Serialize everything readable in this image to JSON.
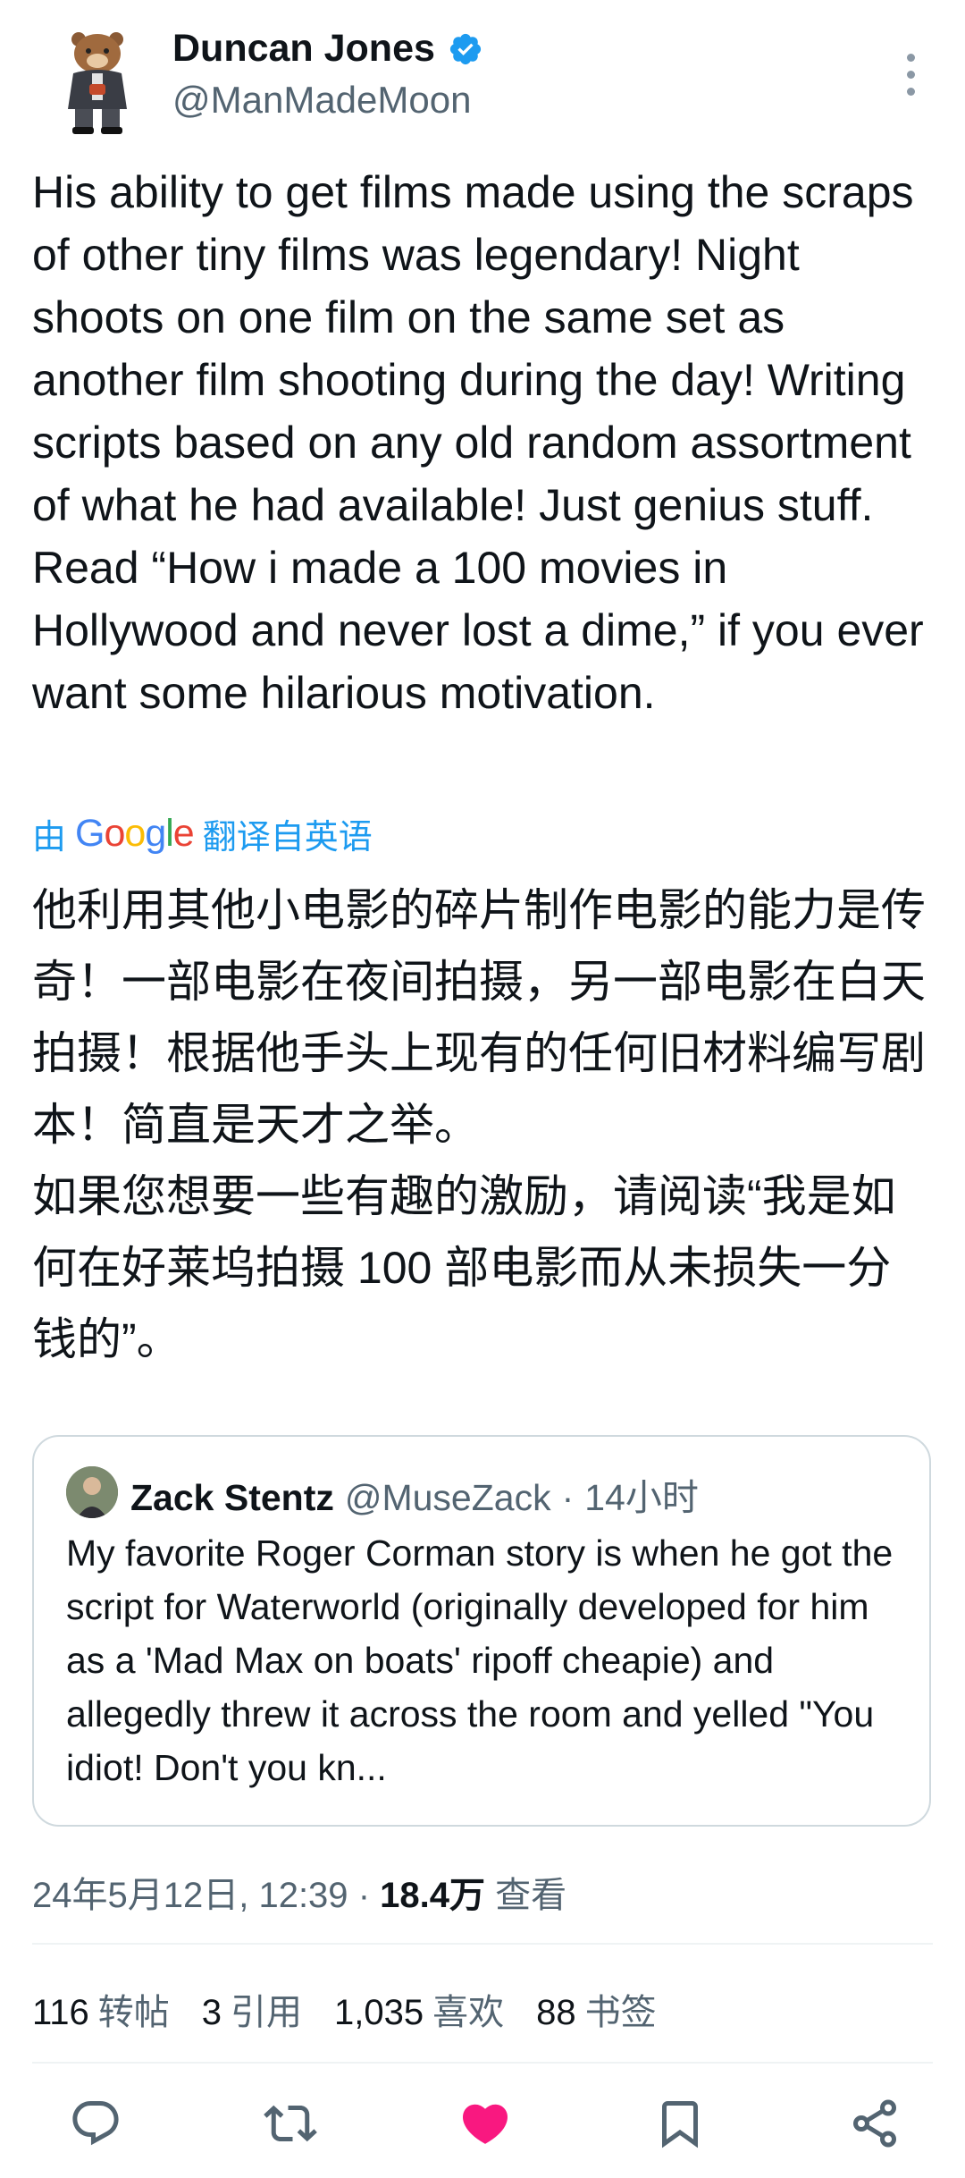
{
  "author": {
    "display_name": "Duncan Jones",
    "handle": "@ManMadeMoon",
    "verified_icon": "verified-badge-icon",
    "avatar_icon": "bear-avatar"
  },
  "tweet": {
    "text": "His ability to get films made using the scraps of other tiny films was legendary!  Night shoots on one film on the same set as another film shooting during the day!  Writing scripts based on any old random assortment of what he had available!  Just genius stuff.\nRead “How i made a 100 movies in Hollywood and never lost a dime,” if you ever want some hilarious motivation.",
    "translate_prefix": "由",
    "translate_suffix": "翻译自英语",
    "translated_text": "他利用其他小电影的碎片制作电影的能力是传奇！一部电影在夜间拍摄，另一部电影在白天拍摄！根据他手头上现有的任何旧材料编写剧本！简直是天才之举。\n如果您想要一些有趣的激励，请阅读“我是如何在好莱坞拍摄 100 部电影而从未损失一分钱的”。"
  },
  "quote": {
    "name": "Zack Stentz",
    "handle": "@MuseZack",
    "separator": "·",
    "time": "14小时",
    "text": "My favorite Roger Corman story is when he got the script for Waterworld (originally developed for him as a 'Mad Max on boats' ripoff cheapie) and allegedly threw it across the room and yelled \"You idiot! Don't you kn..."
  },
  "meta": {
    "date": "24年5月12日, 12:39",
    "separator": "·",
    "views": "18.4万",
    "views_label": "查看"
  },
  "stats": [
    {
      "count": "116",
      "label": "转帖"
    },
    {
      "count": "3",
      "label": "引用"
    },
    {
      "count": "1,035",
      "label": "喜欢"
    },
    {
      "count": "88",
      "label": "书签"
    }
  ],
  "actions": {
    "reply_icon": "reply-icon",
    "retweet_icon": "retweet-icon",
    "like_icon": "heart-icon",
    "bookmark_icon": "bookmark-icon",
    "share_icon": "share-icon",
    "like_color": "#f91880"
  },
  "colors": {
    "link": "#1d9bf0",
    "secondary_text": "#536471",
    "border": "#cfd9de"
  }
}
